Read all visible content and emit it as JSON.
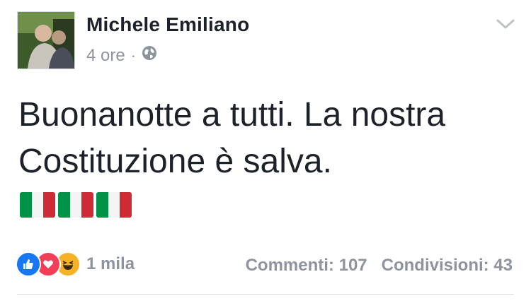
{
  "post": {
    "author": "Michele Emiliano",
    "time": "4 ore",
    "separator": "·",
    "privacy_icon": "globe-icon",
    "text": "Buonanotte a tutti. La nostra Costituzione è salva.",
    "flags": [
      "italy-flag-emoji",
      "italy-flag-emoji",
      "italy-flag-emoji"
    ],
    "menu_icon": "chevron-down-icon"
  },
  "footer": {
    "reaction_icons": [
      "like-icon",
      "love-icon",
      "haha-icon"
    ],
    "reaction_count": "1 mila",
    "comments": "Commenti: 107",
    "shares": "Condivisioni: 43"
  },
  "colors": {
    "like": "#1877f2",
    "love": "#f33e58",
    "haha": "#f7b125",
    "flag_green": "#009246",
    "flag_white": "#ffffff",
    "flag_red": "#ce2b37",
    "muted": "#8d949e"
  }
}
